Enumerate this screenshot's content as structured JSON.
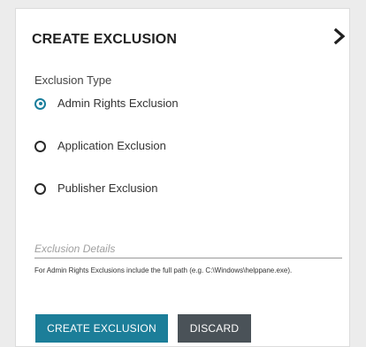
{
  "panel": {
    "title": "CREATE EXCLUSION",
    "collapse_icon": "chevron-right-icon"
  },
  "exclusion_type": {
    "label": "Exclusion Type",
    "selected": "Admin Rights Exclusion",
    "options": [
      {
        "label": "Admin Rights Exclusion",
        "checked": true
      },
      {
        "label": "Application Exclusion",
        "checked": false
      },
      {
        "label": "Publisher Exclusion",
        "checked": false
      }
    ]
  },
  "details": {
    "value": "",
    "placeholder": "Exclusion Details",
    "help_text": "For Admin Rights Exclusions include the full path (e.g. C:\\Windows\\helppane.exe)."
  },
  "actions": {
    "create_label": "CREATE EXCLUSION",
    "discard_label": "DISCARD"
  },
  "colors": {
    "accent": "#1c7e99",
    "secondary_button": "#4a5258",
    "background": "#ececec"
  }
}
